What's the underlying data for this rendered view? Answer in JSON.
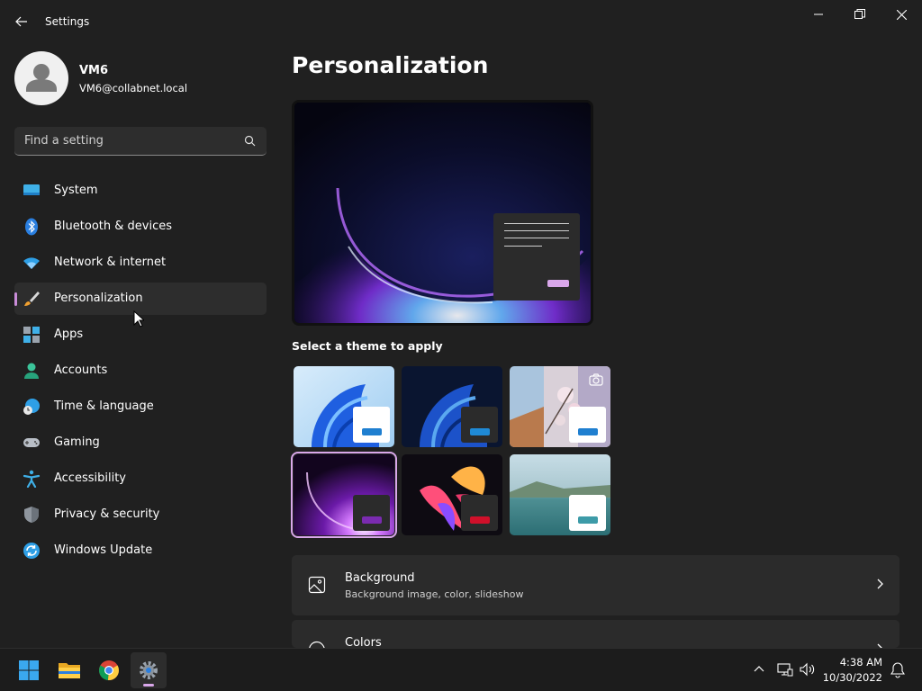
{
  "window": {
    "title": "Settings"
  },
  "user": {
    "name": "VM6",
    "email": "VM6@collabnet.local"
  },
  "search": {
    "placeholder": "Find a setting",
    "value": ""
  },
  "sidebar": {
    "items": [
      {
        "label": "System",
        "icon": "system-icon",
        "active": false
      },
      {
        "label": "Bluetooth & devices",
        "icon": "bluetooth-icon",
        "active": false
      },
      {
        "label": "Network & internet",
        "icon": "wifi-icon",
        "active": false
      },
      {
        "label": "Personalization",
        "icon": "brush-icon",
        "active": true
      },
      {
        "label": "Apps",
        "icon": "apps-icon",
        "active": false
      },
      {
        "label": "Accounts",
        "icon": "person-icon",
        "active": false
      },
      {
        "label": "Time & language",
        "icon": "clock-globe-icon",
        "active": false
      },
      {
        "label": "Gaming",
        "icon": "gamepad-icon",
        "active": false
      },
      {
        "label": "Accessibility",
        "icon": "accessibility-icon",
        "active": false
      },
      {
        "label": "Privacy & security",
        "icon": "shield-icon",
        "active": false
      },
      {
        "label": "Windows Update",
        "icon": "update-icon",
        "active": false
      }
    ]
  },
  "main": {
    "title": "Personalization",
    "themes_label": "Select a theme to apply",
    "themes": [
      {
        "name": "windows-light",
        "selected": false
      },
      {
        "name": "windows-dark",
        "selected": false
      },
      {
        "name": "windows-spotlight",
        "selected": false
      },
      {
        "name": "glow",
        "selected": true
      },
      {
        "name": "captured-motion",
        "selected": false
      },
      {
        "name": "flow",
        "selected": false
      }
    ],
    "cards": [
      {
        "title": "Background",
        "subtitle": "Background image, color, slideshow",
        "icon": "image-icon"
      },
      {
        "title": "Colors",
        "subtitle": "",
        "icon": "palette-icon"
      }
    ]
  },
  "taskbar": {
    "apps": [
      "start-icon",
      "file-explorer-icon",
      "chrome-icon",
      "settings-gear-icon"
    ],
    "time": "4:38 AM",
    "date": "10/30/2022"
  },
  "colors": {
    "accent": "#d9a7ea",
    "background": "#202020",
    "card": "#2b2b2b"
  }
}
